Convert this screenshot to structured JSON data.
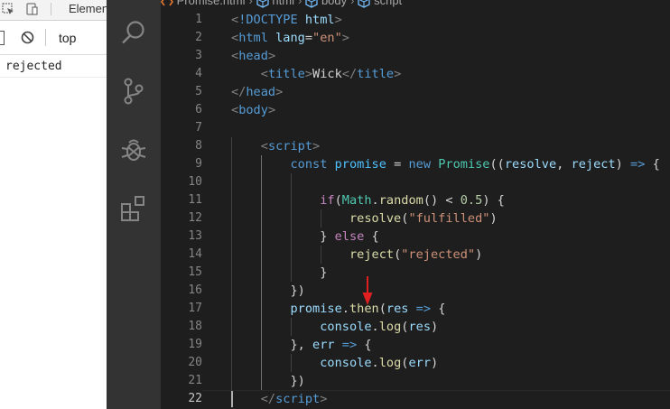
{
  "browser": {
    "tab_label": "Elemen",
    "console_context": "top",
    "console_output": [
      "rejected"
    ]
  },
  "breadcrumb": [
    "Promise.html",
    "html",
    "body",
    "script"
  ],
  "activity_icons": [
    "search-icon",
    "source-control-icon",
    "debug-icon",
    "extensions-icon"
  ],
  "colors": {
    "editor_bg": "#1e1e1e",
    "activity_bg": "#333333",
    "tag": "#569cd6",
    "string": "#ce9178",
    "function": "#dcdcaa",
    "arrow_annotation": "#e02020"
  },
  "line_numbers": [
    "1",
    "2",
    "3",
    "4",
    "5",
    "6",
    "7",
    "8",
    "9",
    "10",
    "11",
    "12",
    "13",
    "14",
    "15",
    "16",
    "17",
    "18",
    "19",
    "20",
    "21",
    "22"
  ],
  "current_line": "22",
  "code": [
    [
      [
        "t-br",
        "<"
      ],
      [
        "t-doc",
        "!DOCTYPE "
      ],
      [
        "t-attr",
        "html"
      ],
      [
        "t-br",
        ">"
      ]
    ],
    [
      [
        "t-br",
        "<"
      ],
      [
        "t-tag",
        "html "
      ],
      [
        "t-attr",
        "lang"
      ],
      [
        "t-txt",
        "="
      ],
      [
        "t-str",
        "\"en\""
      ],
      [
        "t-br",
        ">"
      ]
    ],
    [
      [
        "t-br",
        "<"
      ],
      [
        "t-tag",
        "head"
      ],
      [
        "t-br",
        ">"
      ]
    ],
    [
      [
        "t-txt",
        "    "
      ],
      [
        "t-br",
        "<"
      ],
      [
        "t-tag",
        "title"
      ],
      [
        "t-br",
        ">"
      ],
      [
        "t-txt",
        "Wick"
      ],
      [
        "t-br",
        "</"
      ],
      [
        "t-tag",
        "title"
      ],
      [
        "t-br",
        ">"
      ]
    ],
    [
      [
        "t-br",
        "</"
      ],
      [
        "t-tag",
        "head"
      ],
      [
        "t-br",
        ">"
      ]
    ],
    [
      [
        "t-br",
        "<"
      ],
      [
        "t-tag",
        "body"
      ],
      [
        "t-br",
        ">"
      ]
    ],
    [
      [
        "t-txt",
        ""
      ]
    ],
    [
      [
        "t-txt",
        "    "
      ],
      [
        "t-br",
        "<"
      ],
      [
        "t-tag",
        "script"
      ],
      [
        "t-br",
        ">"
      ]
    ],
    [
      [
        "t-txt",
        "        "
      ],
      [
        "t-kw",
        "const "
      ],
      [
        "t-cst",
        "promise"
      ],
      [
        "t-txt",
        " = "
      ],
      [
        "t-kw",
        "new "
      ],
      [
        "t-cls",
        "Promise"
      ],
      [
        "t-txt",
        "(("
      ],
      [
        "t-var",
        "resolve"
      ],
      [
        "t-txt",
        ", "
      ],
      [
        "t-var",
        "reject"
      ],
      [
        "t-txt",
        ") "
      ],
      [
        "t-kw",
        "=>"
      ],
      [
        "t-txt",
        " {"
      ]
    ],
    [
      [
        "t-txt",
        ""
      ]
    ],
    [
      [
        "t-txt",
        "            "
      ],
      [
        "t-ctl",
        "if"
      ],
      [
        "t-txt",
        "("
      ],
      [
        "t-cls",
        "Math"
      ],
      [
        "t-txt",
        "."
      ],
      [
        "t-fn",
        "random"
      ],
      [
        "t-txt",
        "() < "
      ],
      [
        "t-num",
        "0.5"
      ],
      [
        "t-txt",
        ") {"
      ]
    ],
    [
      [
        "t-txt",
        "                "
      ],
      [
        "t-fn",
        "resolve"
      ],
      [
        "t-txt",
        "("
      ],
      [
        "t-str",
        "\"fulfilled\""
      ],
      [
        "t-txt",
        ")"
      ]
    ],
    [
      [
        "t-txt",
        "            } "
      ],
      [
        "t-ctl",
        "else"
      ],
      [
        "t-txt",
        " {"
      ]
    ],
    [
      [
        "t-txt",
        "                "
      ],
      [
        "t-fn",
        "reject"
      ],
      [
        "t-txt",
        "("
      ],
      [
        "t-str",
        "\"rejected\""
      ],
      [
        "t-txt",
        ")"
      ]
    ],
    [
      [
        "t-txt",
        "            }"
      ]
    ],
    [
      [
        "t-txt",
        "        })"
      ]
    ],
    [
      [
        "t-txt",
        "        "
      ],
      [
        "t-var",
        "promise"
      ],
      [
        "t-txt",
        "."
      ],
      [
        "t-fn",
        "then"
      ],
      [
        "t-txt",
        "("
      ],
      [
        "t-var",
        "res"
      ],
      [
        "t-txt",
        " "
      ],
      [
        "t-kw",
        "=>"
      ],
      [
        "t-txt",
        " {"
      ]
    ],
    [
      [
        "t-txt",
        "            "
      ],
      [
        "t-var",
        "console"
      ],
      [
        "t-txt",
        "."
      ],
      [
        "t-fn",
        "log"
      ],
      [
        "t-txt",
        "("
      ],
      [
        "t-var",
        "res"
      ],
      [
        "t-txt",
        ")"
      ]
    ],
    [
      [
        "t-txt",
        "        }, "
      ],
      [
        "t-var",
        "err"
      ],
      [
        "t-txt",
        " "
      ],
      [
        "t-kw",
        "=>"
      ],
      [
        "t-txt",
        " {"
      ]
    ],
    [
      [
        "t-txt",
        "            "
      ],
      [
        "t-var",
        "console"
      ],
      [
        "t-txt",
        "."
      ],
      [
        "t-fn",
        "log"
      ],
      [
        "t-txt",
        "("
      ],
      [
        "t-var",
        "err"
      ],
      [
        "t-txt",
        ")"
      ]
    ],
    [
      [
        "t-txt",
        "        })"
      ]
    ],
    [
      [
        "t-txt",
        "    "
      ],
      [
        "t-br",
        "</"
      ],
      [
        "t-tag",
        "script"
      ],
      [
        "t-br",
        ">"
      ]
    ]
  ]
}
